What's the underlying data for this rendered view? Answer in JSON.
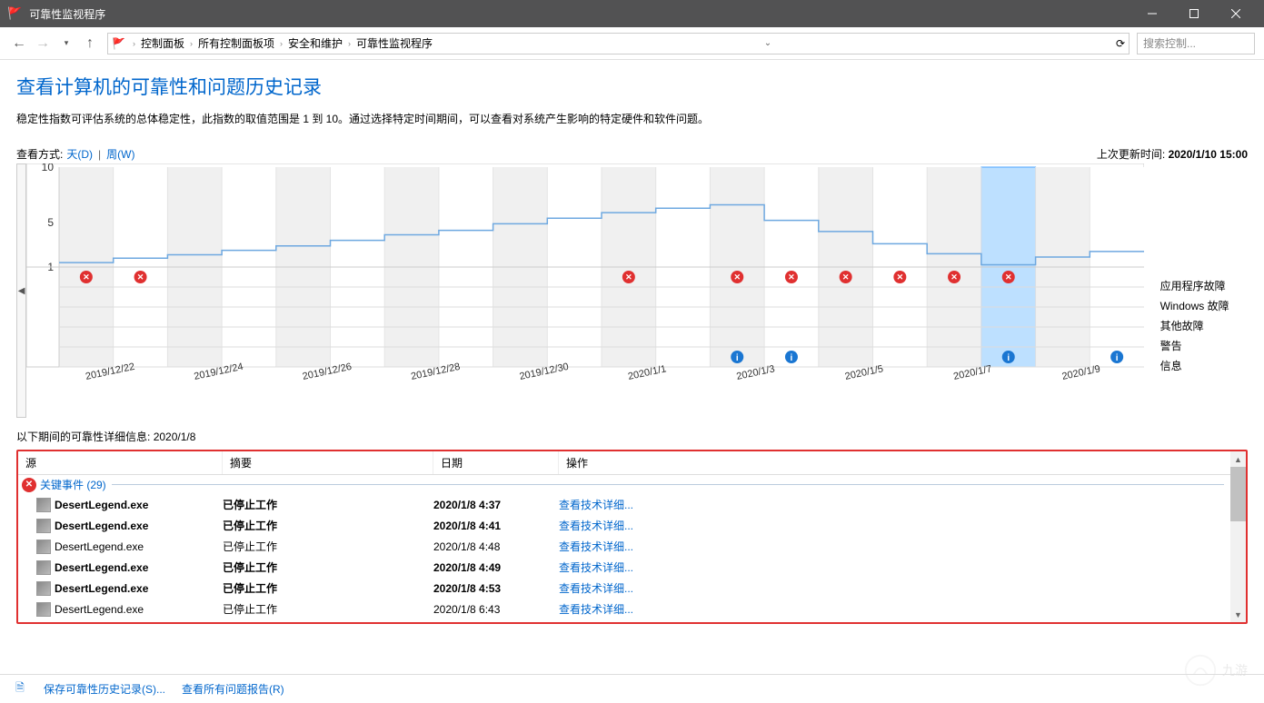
{
  "window": {
    "title": "可靠性监视程序"
  },
  "nav": {
    "breadcrumb": [
      "控制面板",
      "所有控制面板项",
      "安全和维护",
      "可靠性监视程序"
    ],
    "search_placeholder": "搜索控制..."
  },
  "page": {
    "heading": "查看计算机的可靠性和问题历史记录",
    "desc": "稳定性指数可评估系统的总体稳定性，此指数的取值范围是 1 到 10。通过选择特定时间期间，可以查看对系统产生影响的特定硬件和软件问题。"
  },
  "viewbar": {
    "label": "查看方式:",
    "day": "天(D)",
    "week": "周(W)",
    "sep": "|",
    "last_label": "上次更新时间:",
    "last_value": "2020/1/10 15:00"
  },
  "legend": {
    "rows": [
      "应用程序故障",
      "Windows 故障",
      "其他故障",
      "警告",
      "信息"
    ]
  },
  "chart_data": {
    "type": "line",
    "title": "",
    "xlabel": "",
    "ylabel": "",
    "ylim": [
      1,
      10
    ],
    "yticks": [
      1,
      5,
      10
    ],
    "selected_index": 17,
    "categories": [
      "2019/12/22",
      "2019/12/23",
      "2019/12/24",
      "2019/12/25",
      "2019/12/26",
      "2019/12/27",
      "2019/12/28",
      "2019/12/29",
      "2019/12/30",
      "2019/12/31",
      "2020/1/1",
      "2020/1/2",
      "2020/1/3",
      "2020/1/4",
      "2020/1/5",
      "2020/1/6",
      "2020/1/7",
      "2020/1/8",
      "2020/1/9",
      "2020/1/10"
    ],
    "x_tick_labels": [
      "2019/12/22",
      "2019/12/24",
      "2019/12/26",
      "2019/12/28",
      "2019/12/30",
      "2020/1/1",
      "2020/1/3",
      "2020/1/5",
      "2020/1/7",
      "2020/1/9"
    ],
    "series": [
      {
        "name": "稳定性指数",
        "values": [
          1.4,
          1.8,
          2.1,
          2.5,
          2.9,
          3.4,
          3.9,
          4.3,
          4.9,
          5.4,
          5.9,
          6.3,
          6.6,
          5.2,
          4.2,
          3.1,
          2.2,
          1.2,
          1.9,
          2.4
        ]
      }
    ],
    "events": {
      "app_fail": [
        1,
        1,
        0,
        0,
        0,
        0,
        0,
        0,
        0,
        0,
        1,
        0,
        1,
        1,
        1,
        1,
        1,
        1,
        0,
        0
      ],
      "win_fail": [
        0,
        0,
        0,
        0,
        0,
        0,
        0,
        0,
        0,
        0,
        0,
        0,
        0,
        0,
        0,
        0,
        0,
        0,
        0,
        0
      ],
      "other_fail": [
        0,
        0,
        0,
        0,
        0,
        0,
        0,
        0,
        0,
        0,
        0,
        0,
        0,
        0,
        0,
        0,
        0,
        0,
        0,
        0
      ],
      "warning": [
        0,
        0,
        0,
        0,
        0,
        0,
        0,
        0,
        0,
        0,
        0,
        0,
        0,
        0,
        0,
        0,
        0,
        0,
        0,
        0
      ],
      "info": [
        0,
        0,
        0,
        0,
        0,
        0,
        0,
        0,
        0,
        0,
        0,
        0,
        1,
        1,
        0,
        0,
        0,
        1,
        0,
        1
      ]
    }
  },
  "detail": {
    "header_prefix": "以下期间的可靠性详细信息:",
    "header_date": "2020/1/8",
    "cols": [
      "源",
      "摘要",
      "日期",
      "操作"
    ],
    "group_label": "关键事件 (29)",
    "action_text": "查看技术详细...",
    "rows": [
      {
        "source": "DesertLegend.exe",
        "summary": "已停止工作",
        "date": "2020/1/8 4:37",
        "bold": true
      },
      {
        "source": "DesertLegend.exe",
        "summary": "已停止工作",
        "date": "2020/1/8 4:41",
        "bold": true
      },
      {
        "source": "DesertLegend.exe",
        "summary": "已停止工作",
        "date": "2020/1/8 4:48",
        "bold": false
      },
      {
        "source": "DesertLegend.exe",
        "summary": "已停止工作",
        "date": "2020/1/8 4:49",
        "bold": true
      },
      {
        "source": "DesertLegend.exe",
        "summary": "已停止工作",
        "date": "2020/1/8 4:53",
        "bold": true
      },
      {
        "source": "DesertLegend.exe",
        "summary": "已停止工作",
        "date": "2020/1/8 6:43",
        "bold": false
      }
    ]
  },
  "footer": {
    "save": "保存可靠性历史记录(S)...",
    "viewall": "查看所有问题报告(R)"
  },
  "watermark": "九游"
}
